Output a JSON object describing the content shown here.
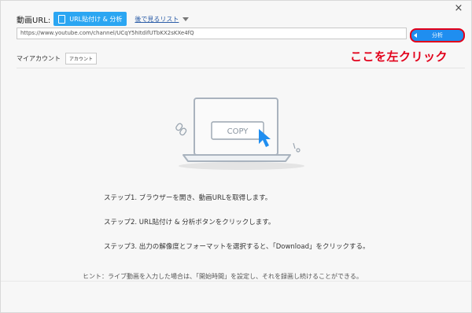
{
  "close_glyph": "×",
  "url_label": "動画URL:",
  "paste_button_label": "URL貼付け & 分析",
  "watch_later_label": "後で見るリスト",
  "url_value": "https://www.youtube.com/channel/UCqY5hItdifUTbKX2sKXe4fQ",
  "analyze_button_label": "分析",
  "annotation_text": "ここを左クリック",
  "my_account_label": "マイアカウント",
  "account_button_label": "アカウント",
  "copy_label": "COPY",
  "steps": [
    "ステップ1. ブラウザーを開き、動画URLを取得します。",
    "ステップ2. URL貼付け & 分析ボタンをクリックします。",
    "ステップ3. 出力の解像度とフォーマットを選択すると、「Download」をクリックする。"
  ],
  "hint": "ヒント：ライブ動画を入力した場合は、「開始時間」を設定し、それを録画し続けることができる。",
  "colors": {
    "accent": "#2ba6f2",
    "annotation": "#e2001a"
  },
  "icons": [
    "close-icon",
    "clipboard-icon",
    "chevron-down-icon",
    "play-left-icon",
    "laptop-icon",
    "link-icon",
    "cursor-arrow-icon"
  ]
}
